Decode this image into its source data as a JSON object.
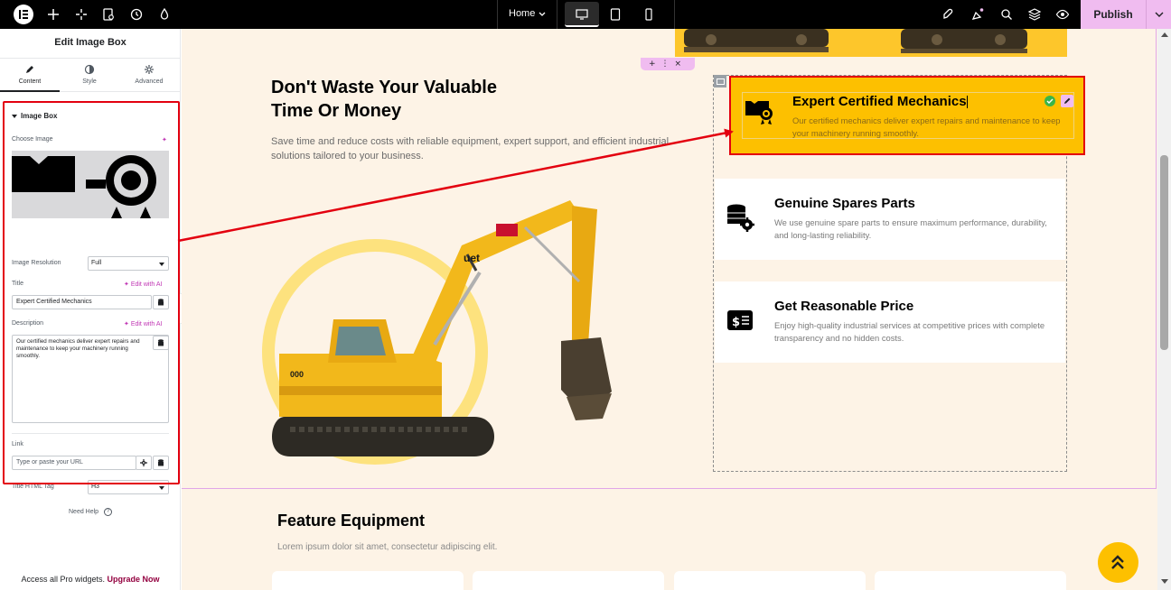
{
  "topbar": {
    "page_selector": "Home",
    "publish_label": "Publish",
    "icons": [
      "elementor-logo-icon",
      "add-icon",
      "structure-icon",
      "page-settings-icon",
      "history-icon",
      "site-settings-icon",
      "desktop-icon",
      "tablet-icon",
      "mobile-icon",
      "launch-icon",
      "notifications-icon",
      "search-icon",
      "navigator-icon",
      "preview-icon",
      "chevron-down-icon"
    ]
  },
  "panel": {
    "title": "Edit Image Box",
    "tabs": [
      {
        "label": "Content",
        "icon": "pencil-icon",
        "active": true
      },
      {
        "label": "Style",
        "icon": "contrast-icon",
        "active": false
      },
      {
        "label": "Advanced",
        "icon": "gear-icon",
        "active": false
      }
    ],
    "section_title": "Image Box",
    "choose_image_label": "Choose Image",
    "image_resolution_label": "Image Resolution",
    "image_resolution_value": "Full",
    "title_label": "Title",
    "edit_with_ai": "Edit with AI",
    "title_value": "Expert Certified Mechanics",
    "description_label": "Description",
    "description_value": "Our certified mechanics deliver expert repairs and maintenance to keep your machinery running smoothly.",
    "link_label": "Link",
    "link_placeholder": "Type or paste your URL",
    "title_tag_label": "Title HTML Tag",
    "title_tag_value": "H3",
    "need_help": "Need Help",
    "pro_text": "Access all Pro widgets.",
    "pro_link": "Upgrade Now"
  },
  "canvas": {
    "hero_title": "Don't Waste Your Valuable Time Or Money",
    "hero_subtitle": "Save time and reduce costs with reliable equipment, expert support, and efficient industrial solutions tailored to your business.",
    "cards": [
      {
        "title": "Expert Certified Mechanics",
        "description": "Our certified mechanics deliver expert repairs and maintenance to keep your machinery running smoothly.",
        "icon": "certificate-envelope-icon",
        "selected": true
      },
      {
        "title": "Genuine Spares Parts",
        "description": "We use genuine spare parts to ensure maximum performance, durability, and long-lasting reliability.",
        "icon": "coins-gear-icon",
        "selected": false
      },
      {
        "title": "Get Reasonable Price",
        "description": "Enjoy high-quality industrial services at competitive prices with complete transparency and no hidden costs.",
        "icon": "dollar-bill-icon",
        "selected": false
      }
    ],
    "feature_title": "Feature Equipment",
    "feature_subtitle": "Lorem ipsum dolor sit amet, consectetur adipiscing elit.",
    "colors": {
      "accent": "#fdc000",
      "editor_pink": "#f0bcf0",
      "annotation_red": "#e3000f",
      "canvas_bg": "#fdf3e6"
    }
  }
}
